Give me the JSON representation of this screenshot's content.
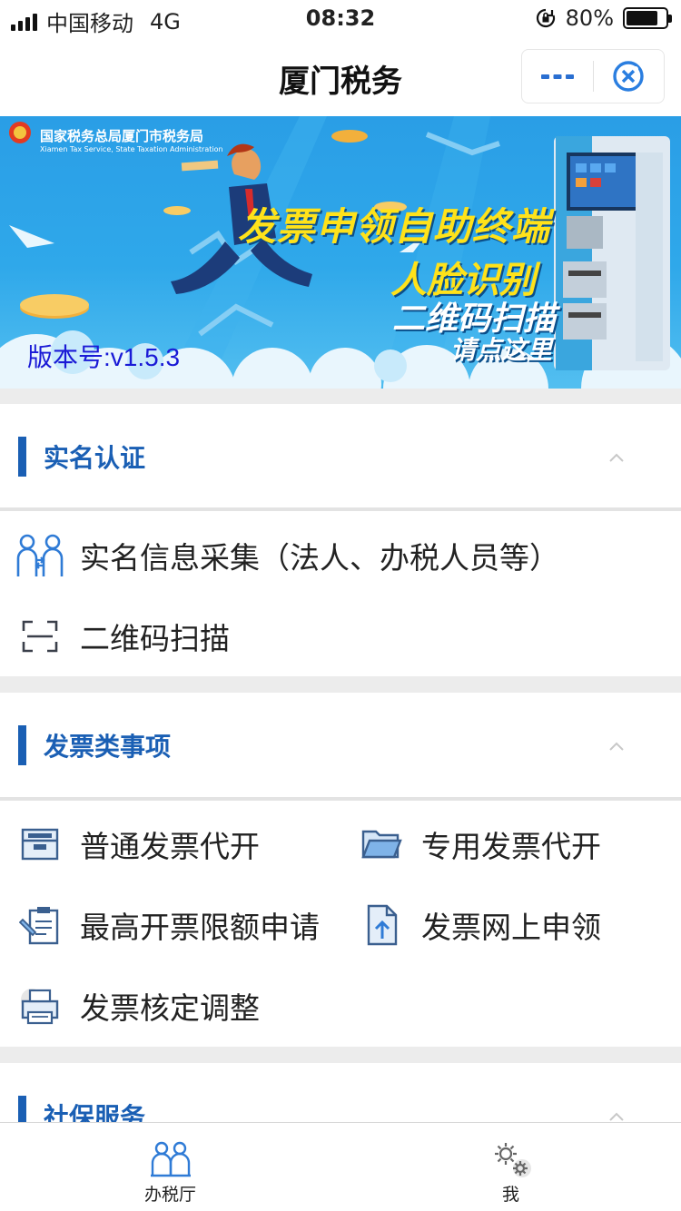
{
  "status_bar": {
    "carrier": "中国移动",
    "network": "4G",
    "time": "08:32",
    "battery": "80%",
    "battery_level": 0.8
  },
  "nav": {
    "title": "厦门税务",
    "more_icon": "more-dots-icon",
    "close_icon": "close-target-icon"
  },
  "banner": {
    "org_name": "国家税务总局厦门市税务局",
    "org_name_en": "Xiamen Tax Service, State Taxation Administration",
    "headline_1": "发票申领自助终端",
    "headline_2": "人脸识别",
    "headline_3": "二维码扫描",
    "headline_4": "请点这里",
    "version": "版本号:v1.5.3"
  },
  "sections": {
    "real_name": {
      "title": "实名认证",
      "items": [
        {
          "label": "实名信息采集（法人、办税人员等）",
          "icon": "people-exchange-icon"
        },
        {
          "label": "二维码扫描",
          "icon": "scan-frame-icon"
        }
      ]
    },
    "invoice": {
      "title": "发票类事项",
      "items": [
        {
          "label": "普通发票代开",
          "icon": "inbox-tray-icon"
        },
        {
          "label": "专用发票代开",
          "icon": "folder-open-icon"
        },
        {
          "label": "最高开票限额申请",
          "icon": "clipboard-pen-icon"
        },
        {
          "label": "发票网上申领",
          "icon": "file-upload-icon"
        },
        {
          "label": "发票核定调整",
          "icon": "printer-icon"
        }
      ]
    },
    "social": {
      "title": "社保服务"
    }
  },
  "tabbar": {
    "tabs": [
      {
        "label": "办税厅",
        "icon": "hall-people-icon"
      },
      {
        "label": "我",
        "icon": "gears-icon"
      }
    ]
  },
  "colors": {
    "accent": "#1a5fb4",
    "icon_blue": "#2f7bd6",
    "banner_bg": "#2fa8ea",
    "banner_yellow": "#ffe21a"
  }
}
